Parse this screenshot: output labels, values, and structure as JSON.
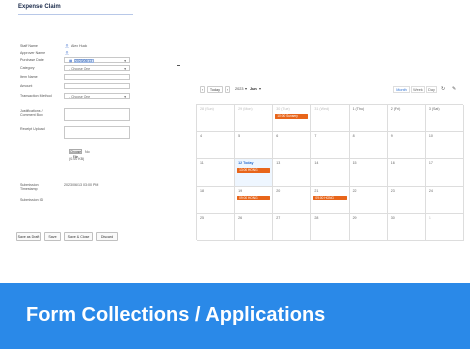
{
  "form": {
    "title": "Expense Claim",
    "fields": [
      {
        "label": "Staff Name",
        "value": "Alex Huck",
        "kind": "user"
      },
      {
        "label": "Approver Name",
        "value": "",
        "kind": "user"
      },
      {
        "label": "Purchase Date",
        "value": "2023/06/13",
        "kind": "date"
      },
      {
        "label": "Category",
        "value": "- Choose One",
        "kind": "select"
      },
      {
        "label": "Item Name",
        "value": "",
        "kind": "text"
      },
      {
        "label": "Amount",
        "value": "",
        "kind": "text"
      },
      {
        "label": "Transaction Method",
        "value": "- Choose One",
        "kind": "select"
      },
      {
        "label": "Justifications / Comment Box",
        "value": "",
        "kind": "textarea"
      },
      {
        "label": "Receipt Upload",
        "value": "",
        "kind": "file"
      }
    ],
    "file_button": "Choose File",
    "file_status": "No",
    "file_size": "(0.00 KB)",
    "submission_timestamp_label": "Submission Timestamp",
    "submission_timestamp_value": "2023/06/13 03:00 PM",
    "submission_id_label": "Submission ID",
    "buttons": [
      "Save as Draft",
      "Save",
      "Save & Close",
      "Discard"
    ]
  },
  "calendar": {
    "today_button": "Today",
    "year": "2023",
    "month": "Jun",
    "views": [
      "Month",
      "Week",
      "Day"
    ],
    "refresh_icon": "refresh-icon",
    "settings_icon": "wrench-icon",
    "rows": [
      [
        {
          "date": "28 (Sun)",
          "muted": true
        },
        {
          "date": "29 (Mon)",
          "muted": true
        },
        {
          "date": "30 (Tue)",
          "muted": true,
          "event": "10:00 Sunsery"
        },
        {
          "date": "31 (Wed)",
          "muted": true
        },
        {
          "date": "1 (Thu)"
        },
        {
          "date": "2 (Fri)"
        },
        {
          "date": "3 (Sat)"
        }
      ],
      [
        {
          "date": "4"
        },
        {
          "date": "5"
        },
        {
          "date": "6"
        },
        {
          "date": "7"
        },
        {
          "date": "8"
        },
        {
          "date": "9"
        },
        {
          "date": "10"
        }
      ],
      [
        {
          "date": "11"
        },
        {
          "date": "12 Today",
          "today": true,
          "event": "13:00 HONG"
        },
        {
          "date": "13"
        },
        {
          "date": "14"
        },
        {
          "date": "15"
        },
        {
          "date": "16"
        },
        {
          "date": "17"
        }
      ],
      [
        {
          "date": "18"
        },
        {
          "date": "19",
          "event": "09:00 HONG"
        },
        {
          "date": "20"
        },
        {
          "date": "21",
          "event": "09:00 HONG"
        },
        {
          "date": "22"
        },
        {
          "date": "23"
        },
        {
          "date": "24"
        }
      ],
      [
        {
          "date": "25"
        },
        {
          "date": "26"
        },
        {
          "date": "27"
        },
        {
          "date": "28"
        },
        {
          "date": "29"
        },
        {
          "date": "30"
        },
        {
          "date": "1",
          "muted": true
        }
      ]
    ]
  },
  "banner": {
    "text": "Form Collections / Applications",
    "color": "#2a89e8"
  },
  "colors": {
    "accent": "#2c6fd0",
    "event": "#e8651a"
  }
}
